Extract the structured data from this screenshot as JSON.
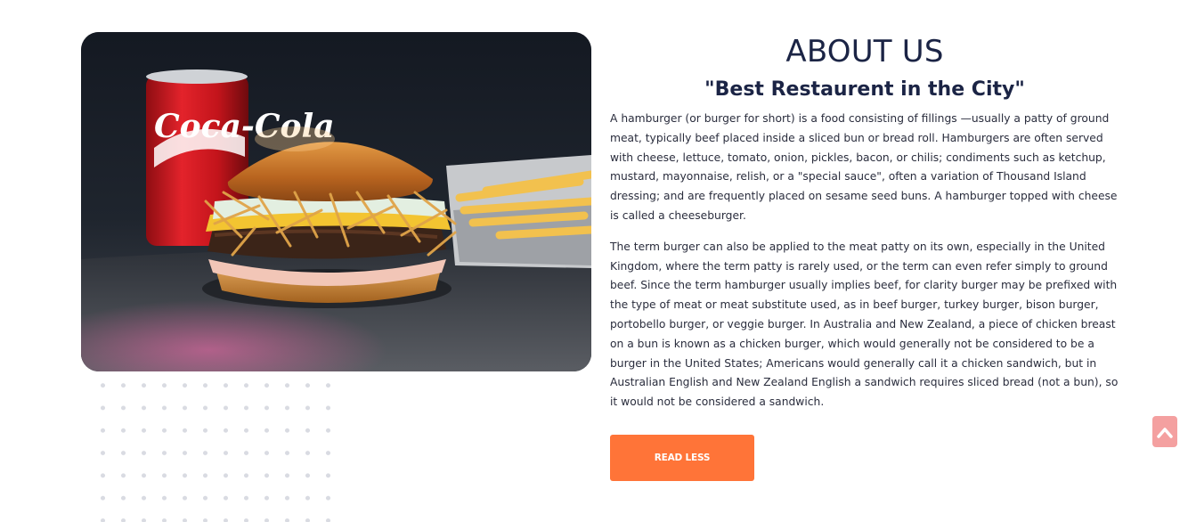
{
  "about": {
    "title": "ABOUT US",
    "tagline": "\"Best Restaurent in the City\"",
    "paragraph_1": "A hamburger (or burger for short) is a food consisting of fillings —usually a patty of ground meat, typically beef placed inside a sliced bun or bread roll. Hamburgers are often served with cheese, lettuce, tomato, onion, pickles, bacon, or chilis; condiments such as ketchup, mustard, mayonnaise, relish, or a \"special sauce\", often a variation of Thousand Island dressing; and are frequently placed on sesame seed buns. A hamburger topped with cheese is called a cheeseburger.",
    "paragraph_2": "The term burger can also be applied to the meat patty on its own, especially in the United Kingdom, where the term patty is rarely used, or the term can even refer simply to ground beef. Since the term hamburger usually implies beef, for clarity burger may be prefixed with the type of meat or meat substitute used, as in beef burger, turkey burger, bison burger, portobello burger, or veggie burger. In Australia and New Zealand, a piece of chicken breast on a bun is known as a chicken burger, which would generally not be considered to be a burger in the United States; Americans would generally call it a chicken sandwich, but in Australian English and New Zealand English a sandwich requires sliced bread (not a bun), so it would not be considered a sandwich.",
    "button_label": "READ LESS"
  },
  "hero": {
    "can_text": "Coca-Cola"
  },
  "icons": {
    "scroll_top": "chevron-up-icon"
  },
  "colors": {
    "heading": "#1b2445",
    "button_bg": "#ff7438",
    "scroll_top_bg": "#f4a0a0"
  }
}
